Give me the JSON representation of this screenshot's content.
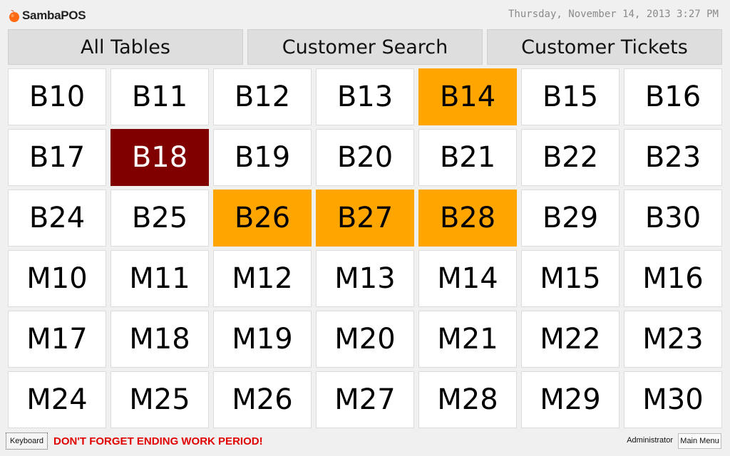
{
  "header": {
    "app_name": "SambaPOS",
    "datetime": "Thursday, November 14, 2013 3:27 PM"
  },
  "tabs": [
    {
      "label": "All Tables"
    },
    {
      "label": "Customer Search"
    },
    {
      "label": "Customer Tickets"
    }
  ],
  "tables": [
    {
      "name": "B10",
      "status": "available"
    },
    {
      "name": "B11",
      "status": "available"
    },
    {
      "name": "B12",
      "status": "available"
    },
    {
      "name": "B13",
      "status": "available"
    },
    {
      "name": "B14",
      "status": "busy"
    },
    {
      "name": "B15",
      "status": "available"
    },
    {
      "name": "B16",
      "status": "available"
    },
    {
      "name": "B17",
      "status": "available"
    },
    {
      "name": "B18",
      "status": "locked"
    },
    {
      "name": "B19",
      "status": "available"
    },
    {
      "name": "B20",
      "status": "available"
    },
    {
      "name": "B21",
      "status": "available"
    },
    {
      "name": "B22",
      "status": "available"
    },
    {
      "name": "B23",
      "status": "available"
    },
    {
      "name": "B24",
      "status": "available"
    },
    {
      "name": "B25",
      "status": "available"
    },
    {
      "name": "B26",
      "status": "busy"
    },
    {
      "name": "B27",
      "status": "busy"
    },
    {
      "name": "B28",
      "status": "busy"
    },
    {
      "name": "B29",
      "status": "available"
    },
    {
      "name": "B30",
      "status": "available"
    },
    {
      "name": "M10",
      "status": "available"
    },
    {
      "name": "M11",
      "status": "available"
    },
    {
      "name": "M12",
      "status": "available"
    },
    {
      "name": "M13",
      "status": "available"
    },
    {
      "name": "M14",
      "status": "available"
    },
    {
      "name": "M15",
      "status": "available"
    },
    {
      "name": "M16",
      "status": "available"
    },
    {
      "name": "M17",
      "status": "available"
    },
    {
      "name": "M18",
      "status": "available"
    },
    {
      "name": "M19",
      "status": "available"
    },
    {
      "name": "M20",
      "status": "available"
    },
    {
      "name": "M21",
      "status": "available"
    },
    {
      "name": "M22",
      "status": "available"
    },
    {
      "name": "M23",
      "status": "available"
    },
    {
      "name": "M24",
      "status": "available"
    },
    {
      "name": "M25",
      "status": "available"
    },
    {
      "name": "M26",
      "status": "available"
    },
    {
      "name": "M27",
      "status": "available"
    },
    {
      "name": "M28",
      "status": "available"
    },
    {
      "name": "M29",
      "status": "available"
    },
    {
      "name": "M30",
      "status": "available"
    }
  ],
  "colors": {
    "available": "#ffffff",
    "busy": "#ffa500",
    "locked": "#800000",
    "warning": "#e00000"
  },
  "footer": {
    "keyboard_label": "Keyboard",
    "warning_text": "DON'T FORGET ENDING WORK PERIOD!",
    "user_name": "Administrator",
    "main_menu_label": "Main Menu"
  }
}
